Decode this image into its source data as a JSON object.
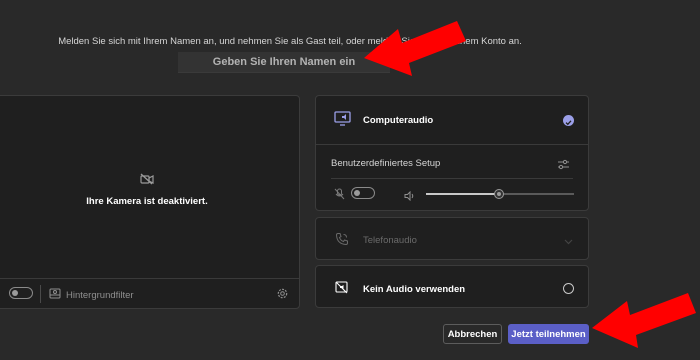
{
  "intro_text": "Melden Sie sich mit Ihrem Namen an, und nehmen Sie als Gast teil, oder melden Sie sich mit einem Konto an.",
  "name_input": {
    "placeholder": "Geben Sie Ihren Namen ein",
    "value": ""
  },
  "camera": {
    "status_text": "Ihre Kamera ist deaktiviert.",
    "background_filter_label": "Hintergrundfilter",
    "camera_on": false
  },
  "audio_options": {
    "computer_audio": {
      "label": "Computeraudio",
      "selected": true
    },
    "custom_setup_label": "Benutzerdefiniertes Setup",
    "mic_on": false,
    "speaker_volume": 0.49,
    "phone_audio": {
      "label": "Telefonaudio",
      "disabled": true
    },
    "no_audio": {
      "label": "Kein Audio verwenden",
      "selected": false
    }
  },
  "buttons": {
    "cancel": "Abbrechen",
    "join": "Jetzt teilnehmen"
  },
  "colors": {
    "accent": "#5b5fc7",
    "check": "#9b9fe8",
    "arrow": "#ff0000",
    "background": "#292929"
  },
  "icons": {
    "camera_off": "camera-off-icon",
    "background_filter": "background-filter-icon",
    "settings": "gear-icon",
    "computer_audio": "computer-audio-icon",
    "selected": "checkmark-icon",
    "setup": "sliders-icon",
    "mic_off": "mic-off-icon",
    "speaker": "speaker-icon",
    "phone": "phone-icon",
    "no_audio": "no-audio-icon"
  }
}
